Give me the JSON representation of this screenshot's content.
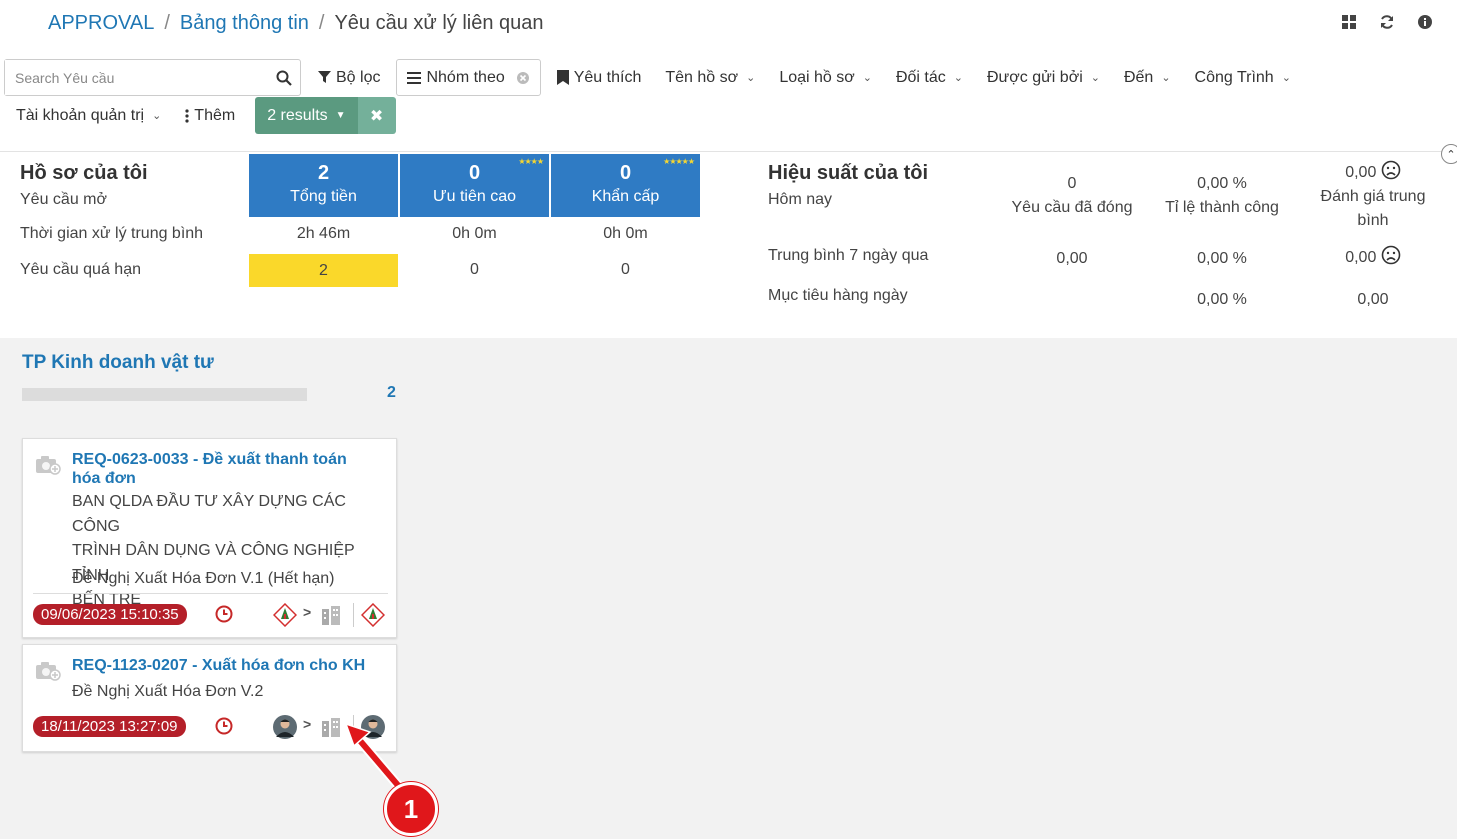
{
  "breadcrumb": {
    "root": "APPROVAL",
    "parent": "Bảng thông tin",
    "current": "Yêu cầu xử lý liên quan"
  },
  "top_icons": [
    "grid-icon",
    "refresh-icon",
    "info-icon"
  ],
  "search": {
    "placeholder": "Search Yêu cầu"
  },
  "filters": {
    "filter_label": "Bộ lọc",
    "group_label": "Nhóm theo",
    "favorite_label": "Yêu thích",
    "dropdowns": [
      "Tên hồ sơ",
      "Loại hồ sơ",
      "Đối tác",
      "Được gửi bởi",
      "Đến",
      "Công Trình"
    ],
    "admin_account": "Tài khoản quản trị",
    "more": "Thêm",
    "results": "2 results"
  },
  "my_docs": {
    "title": "Hồ sơ của tôi",
    "row_labels": [
      "Yêu cầu mở",
      "Thời gian xử lý trung bình",
      "Yêu cầu quá hạn"
    ],
    "tiles": [
      {
        "count": "2",
        "label": "Tổng tiền",
        "stars": ""
      },
      {
        "count": "0",
        "label": "Ưu tiên cao",
        "stars": "★★★★"
      },
      {
        "count": "0",
        "label": "Khẩn cấp",
        "stars": "★★★★★"
      }
    ],
    "avg_time": [
      "2h 46m",
      "0h 0m",
      "0h 0m"
    ],
    "overdue": [
      "2",
      "0",
      "0"
    ]
  },
  "performance": {
    "title": "Hiệu suất của tôi",
    "row_labels": [
      "Hôm nay",
      "Trung bình 7 ngày qua",
      "Mục tiêu hàng ngày"
    ],
    "col_labels": [
      "Yêu cầu đã đóng",
      "Tỉ lệ thành công",
      "Đánh giá trung bình"
    ],
    "today": [
      "0",
      "0,00 %",
      "0,00"
    ],
    "week": [
      "0,00",
      "0,00 %",
      "0,00"
    ],
    "target": [
      "",
      "0,00 %",
      "0,00"
    ]
  },
  "kanban": {
    "column_title": "TP Kinh doanh vật tư",
    "column_count": "2",
    "column_progress": 0,
    "cards": [
      {
        "title_line1": "REQ-0623-0033 - Đề xuất thanh toán",
        "title_line2": "hóa đơn",
        "partner": [
          "BAN QLDA ĐẦU TƯ XÂY DỰNG CÁC CÔNG",
          "TRÌNH DÂN DỤNG VÀ CÔNG NGHIỆP TỈNH",
          "BẾN TRE"
        ],
        "template": "Đề Nghị Xuất Hóa Đơn V.1 (Hết hạn)",
        "date": "09/06/2023 15:10:35"
      },
      {
        "title_line1": "REQ-1123-0207 - Xuất hóa đơn cho KH",
        "template": "Đề Nghị Xuất Hóa Đơn V.2",
        "date": "18/11/2023 13:27:09"
      }
    ]
  },
  "annotation": {
    "number": "1",
    "color": "#e0171b"
  }
}
